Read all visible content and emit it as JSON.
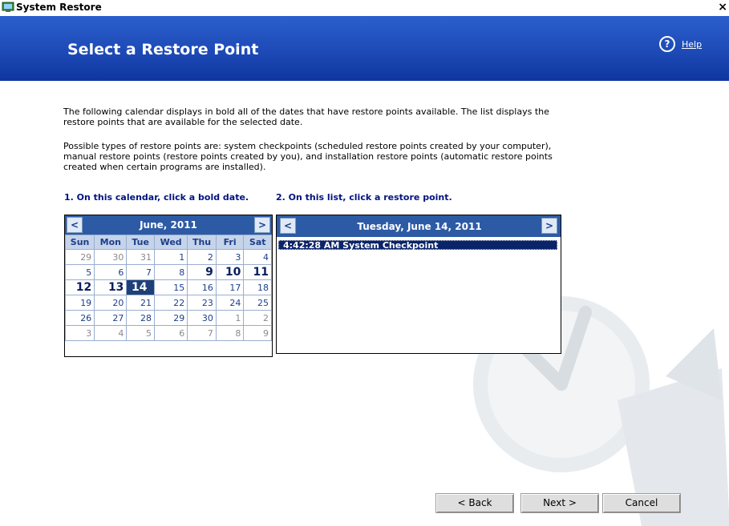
{
  "window": {
    "title": "System Restore",
    "close_glyph": "×"
  },
  "header": {
    "heading": "Select a Restore Point",
    "help_label": "Help",
    "help_icon": "help-icon"
  },
  "intro": {
    "paragraph1": "The following calendar displays in bold all of the dates that have restore points available. The list displays the restore points that are available for the selected date.",
    "paragraph2": "Possible types of restore points are: system checkpoints (scheduled restore points created by your computer), manual restore points (restore points created by you), and installation restore points (automatic restore points created when certain programs are installed)."
  },
  "steps": {
    "calendar_step": "1. On this calendar, click a bold date.",
    "list_step": "2. On this list, click a restore point."
  },
  "calendar": {
    "prev": "<",
    "next": ">",
    "month_label": "June, 2011",
    "weekdays": [
      "Sun",
      "Mon",
      "Tue",
      "Wed",
      "Thu",
      "Fri",
      "Sat"
    ],
    "weeks": [
      [
        {
          "d": "29",
          "t": "other"
        },
        {
          "d": "30",
          "t": "other"
        },
        {
          "d": "31",
          "t": "other"
        },
        {
          "d": "1",
          "t": ""
        },
        {
          "d": "2",
          "t": ""
        },
        {
          "d": "3",
          "t": ""
        },
        {
          "d": "4",
          "t": ""
        }
      ],
      [
        {
          "d": "5",
          "t": ""
        },
        {
          "d": "6",
          "t": ""
        },
        {
          "d": "7",
          "t": ""
        },
        {
          "d": "8",
          "t": ""
        },
        {
          "d": "9",
          "t": "bold"
        },
        {
          "d": "10",
          "t": "bold"
        },
        {
          "d": "11",
          "t": "bold"
        }
      ],
      [
        {
          "d": "12",
          "t": "bold"
        },
        {
          "d": "13",
          "t": "bold"
        },
        {
          "d": "14",
          "t": "sel"
        },
        {
          "d": "15",
          "t": ""
        },
        {
          "d": "16",
          "t": ""
        },
        {
          "d": "17",
          "t": ""
        },
        {
          "d": "18",
          "t": ""
        }
      ],
      [
        {
          "d": "19",
          "t": ""
        },
        {
          "d": "20",
          "t": ""
        },
        {
          "d": "21",
          "t": ""
        },
        {
          "d": "22",
          "t": ""
        },
        {
          "d": "23",
          "t": ""
        },
        {
          "d": "24",
          "t": ""
        },
        {
          "d": "25",
          "t": ""
        }
      ],
      [
        {
          "d": "26",
          "t": ""
        },
        {
          "d": "27",
          "t": ""
        },
        {
          "d": "28",
          "t": ""
        },
        {
          "d": "29",
          "t": ""
        },
        {
          "d": "30",
          "t": ""
        },
        {
          "d": "1",
          "t": "other"
        },
        {
          "d": "2",
          "t": "other"
        }
      ],
      [
        {
          "d": "3",
          "t": "other"
        },
        {
          "d": "4",
          "t": "other"
        },
        {
          "d": "5",
          "t": "other"
        },
        {
          "d": "6",
          "t": "other"
        },
        {
          "d": "7",
          "t": "other"
        },
        {
          "d": "8",
          "t": "other"
        },
        {
          "d": "9",
          "t": "other"
        }
      ]
    ]
  },
  "restore_list": {
    "prev": "<",
    "next": ">",
    "date_label": "Tuesday, June 14, 2011",
    "items": [
      {
        "label": "4:42:28 AM  System Checkpoint"
      }
    ]
  },
  "buttons": {
    "back": "< Back",
    "next": "Next >",
    "cancel": "Cancel"
  }
}
